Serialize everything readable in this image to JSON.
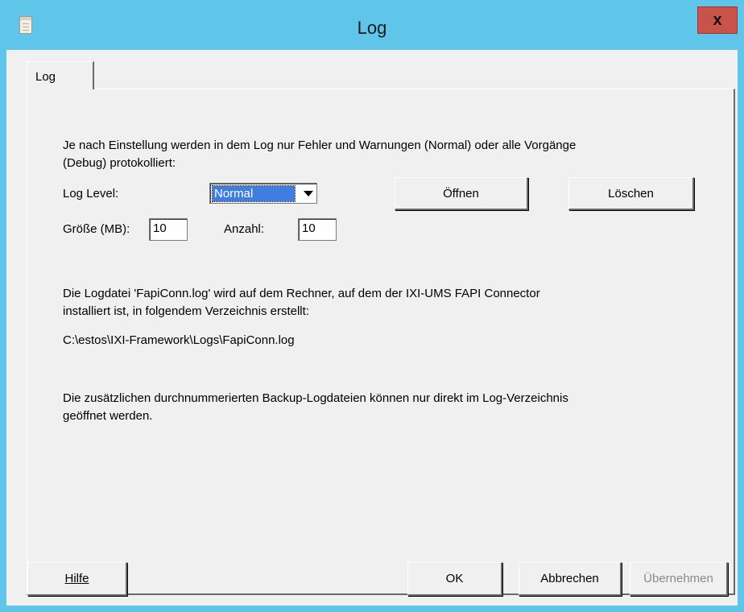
{
  "window": {
    "title": "Log",
    "close_label": "x"
  },
  "tabs": [
    {
      "label": "Log"
    }
  ],
  "panel": {
    "intro_line1": "Je nach Einstellung werden in dem Log nur Fehler und Warnungen (Normal) oder alle Vorgänge",
    "intro_line2": "(Debug) protokolliert:",
    "log_level_label": "Log Level:",
    "log_level_value": "Normal",
    "open_button": "Öffnen",
    "delete_button": "Löschen",
    "size_label": "Größe (MB):",
    "size_value": "10",
    "count_label": "Anzahl:",
    "count_value": "10",
    "info_line1": "Die Logdatei 'FapiConn.log' wird auf dem Rechner, auf dem der IXI-UMS FAPI Connector",
    "info_line2": "installiert ist, in folgendem Verzeichnis erstellt:",
    "log_path": "C:\\estos\\IXI-Framework\\Logs\\FapiConn.log",
    "backup_line1": "Die zusätzlichen durchnummerierten Backup-Logdateien können nur direkt im Log-Verzeichnis",
    "backup_line2": "geöffnet werden."
  },
  "footer": {
    "help_button": "Hilfe",
    "ok_button": "OK",
    "cancel_button": "Abbrechen",
    "apply_button": "Übernehmen"
  },
  "colors": {
    "titlebar": "#5fc6ea",
    "close": "#c7534a",
    "selection": "#3f7ee0"
  }
}
